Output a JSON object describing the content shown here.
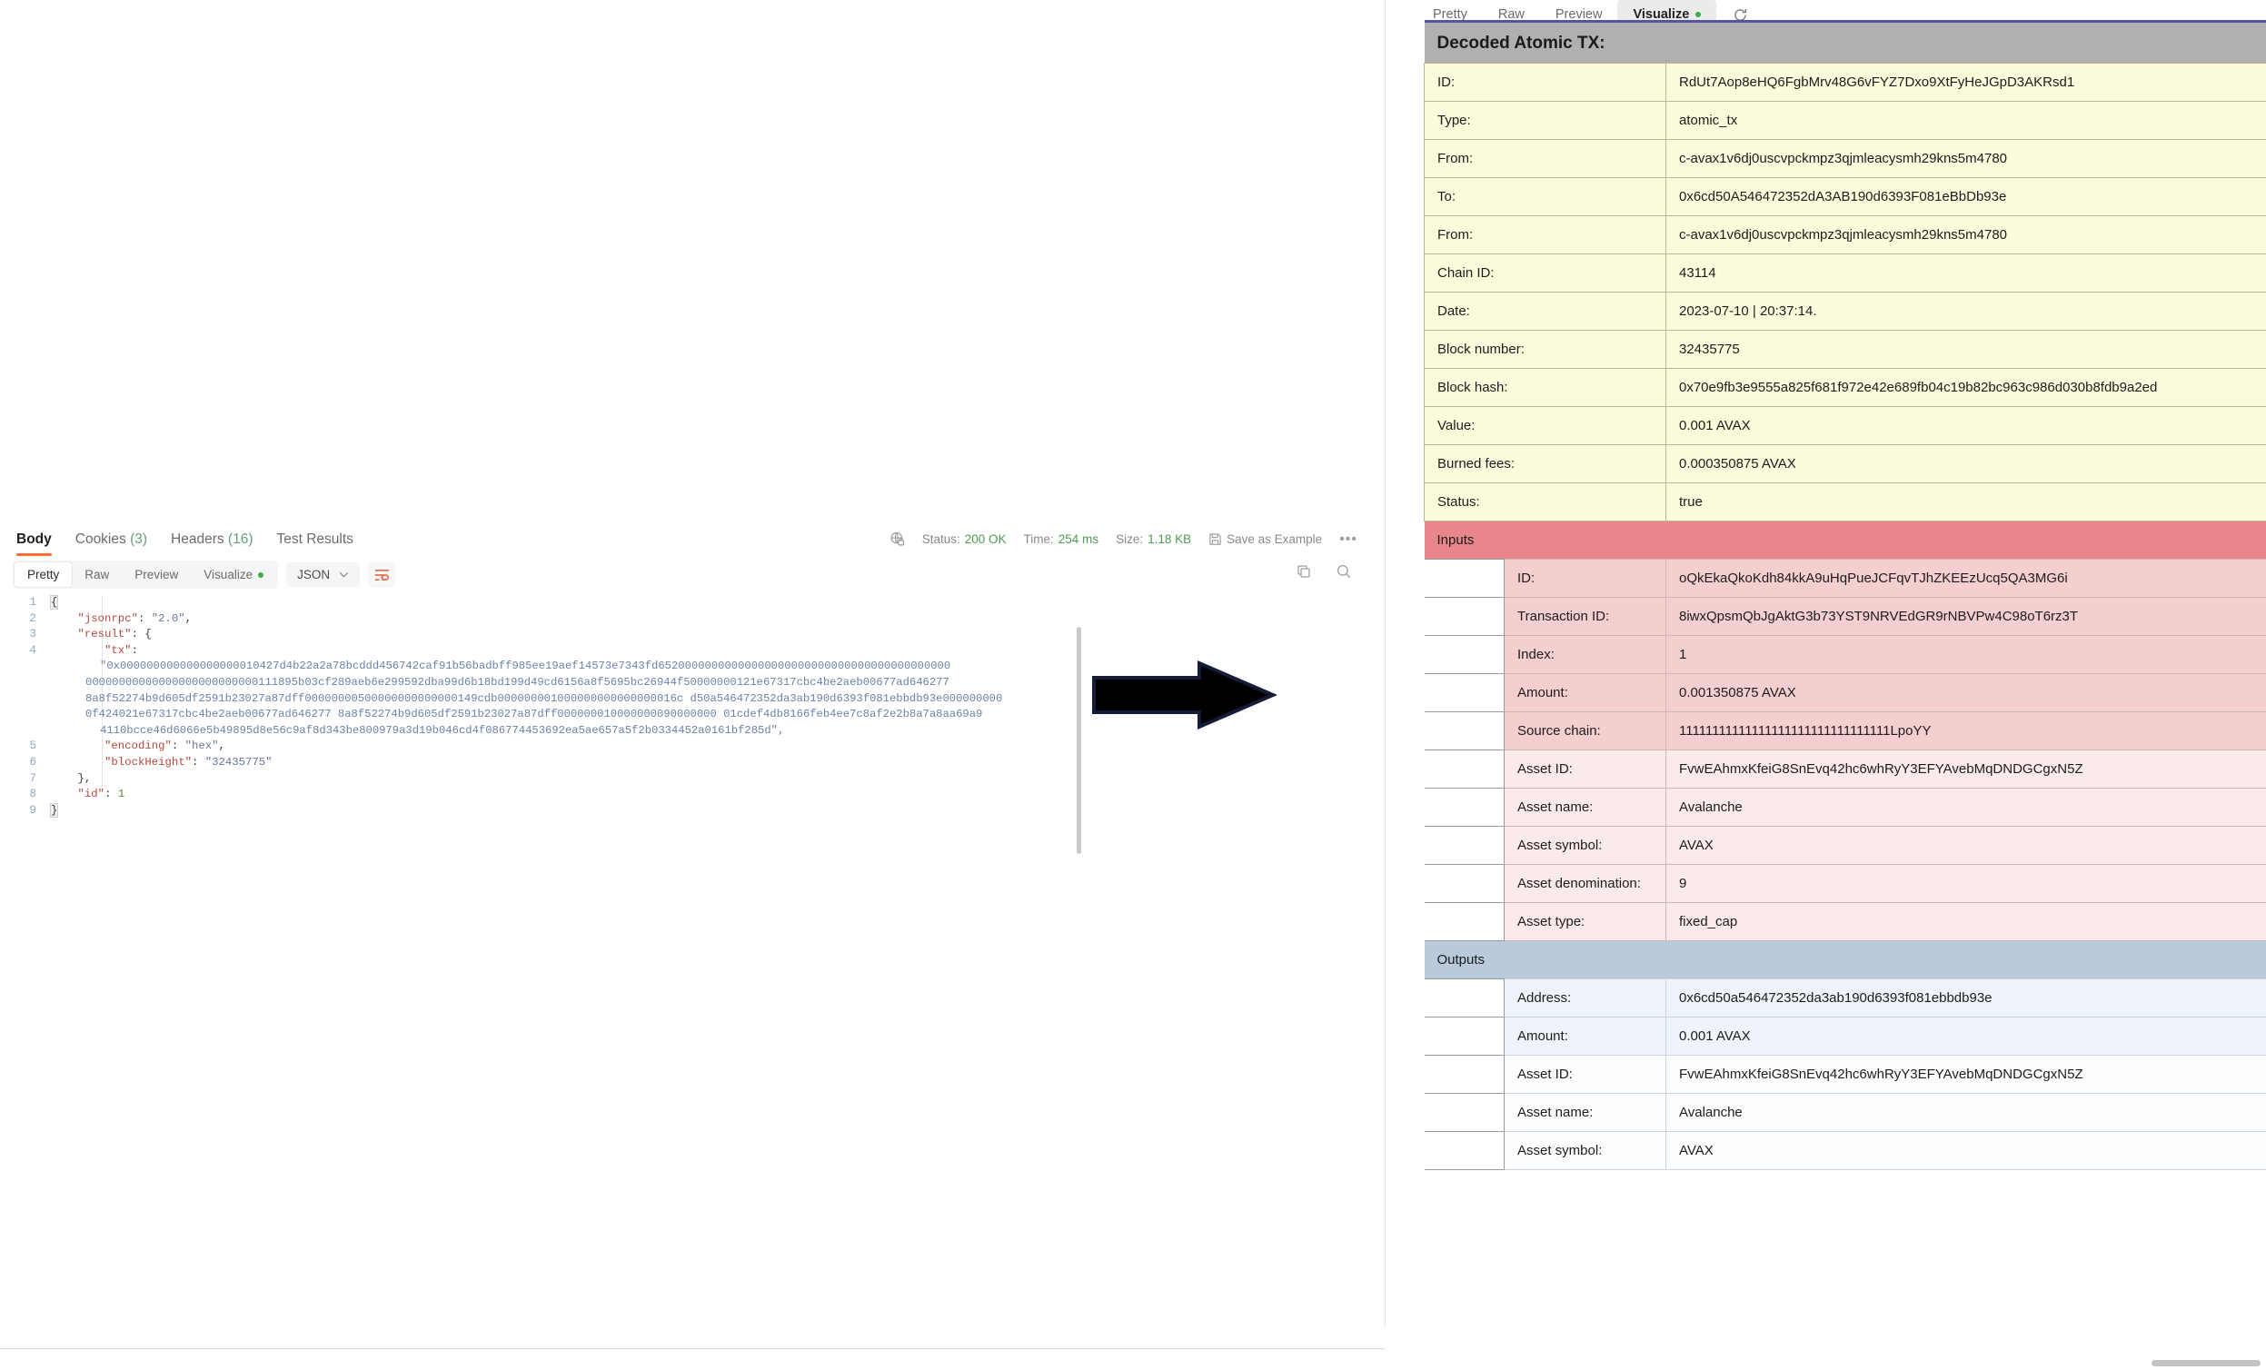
{
  "postman": {
    "response_tabs": [
      {
        "label": "Body",
        "count": "",
        "active": true
      },
      {
        "label": "Cookies",
        "count": "(3)",
        "active": false
      },
      {
        "label": "Headers",
        "count": "(16)",
        "active": false
      },
      {
        "label": "Test Results",
        "count": "",
        "active": false
      }
    ],
    "status": {
      "status_label": "Status:",
      "status_value": "200 OK",
      "time_label": "Time:",
      "time_value": "254 ms",
      "size_label": "Size:",
      "size_value": "1.18 KB",
      "save_as_example": "Save as Example",
      "more": "•••"
    },
    "format_tabs": [
      {
        "label": "Pretty",
        "active": true,
        "dot": false
      },
      {
        "label": "Raw",
        "active": false,
        "dot": false
      },
      {
        "label": "Preview",
        "active": false,
        "dot": false
      },
      {
        "label": "Visualize",
        "active": false,
        "dot": true
      }
    ],
    "language": "JSON",
    "code_lines": [
      {
        "num": "1",
        "type": "plain",
        "text": "{"
      },
      {
        "num": "2",
        "type": "kv",
        "key": "\"jsonrpc\"",
        "val": "\"2.0\"",
        "tail": ","
      },
      {
        "num": "3",
        "type": "open",
        "key": "\"result\"",
        "tail": "{"
      },
      {
        "num": "4",
        "type": "key",
        "key": "\"tx\"",
        "tail": ":"
      },
      {
        "num": "5",
        "type": "kv2",
        "key": "\"encoding\"",
        "val": "\"hex\"",
        "tail": ","
      },
      {
        "num": "6",
        "type": "kv2",
        "key": "\"blockHeight\"",
        "val": "\"32435775\"",
        "tail": ""
      },
      {
        "num": "7",
        "type": "plain2",
        "text": "},"
      },
      {
        "num": "8",
        "type": "kvnum",
        "key": "\"id\"",
        "val": "1",
        "tail": ""
      },
      {
        "num": "9",
        "type": "plain",
        "text": "}"
      }
    ],
    "hex_lines": [
      "\"0x000000000000000000010427d4b22a2a78bcddd456742caf91b56badbff985ee19aef14573e7343fd65200000000000000000000000000000000000000000",
      "00000000000000000000000000111895b03cf289aeb6e299592dba99d6b18bd199d49cd6156a8f5695bc26944f50000000121e67317cbc4be2aeb00677ad646277",
      "8a8f52274b9d605df2591b23027a87dff00000000500000000000000149cdb000000001000000000000000016c d50a546472352da3ab190d6393f081ebbdb93e000000000",
      "0f424021e67317cbc4be2aeb00677ad646277 8a8f52274b9d605df2591b23027a87dff000000010000000090000000 01cdef4db8166feb4ee7c8af2e2b8a7a8aa69a9",
      "4110bcce46d6066e5b49895d8e56c9af8d343be800979a3d19b046cd4f086774453692ea5ae657a5f2b0334452a0161bf285d\","
    ]
  },
  "visualize": {
    "tabs": [
      {
        "label": "Pretty",
        "active": false,
        "dot": false
      },
      {
        "label": "Raw",
        "active": false,
        "dot": false
      },
      {
        "label": "Preview",
        "active": false,
        "dot": false
      },
      {
        "label": "Visualize",
        "active": true,
        "dot": true
      }
    ],
    "title": "Decoded Atomic TX:",
    "main_rows": [
      {
        "label": "ID:",
        "value": "RdUt7Aop8eHQ6FgbMrv48G6vFYZ7Dxo9XtFyHeJGpD3AKRsd1"
      },
      {
        "label": "Type:",
        "value": "atomic_tx"
      },
      {
        "label": "From:",
        "value": "c-avax1v6dj0uscvpckmpz3qjmleacysmh29kns5m4780"
      },
      {
        "label": "To:",
        "value": "0x6cd50A546472352dA3AB190d6393F081eBbDb93e"
      },
      {
        "label": "From:",
        "value": "c-avax1v6dj0uscvpckmpz3qjmleacysmh29kns5m4780"
      },
      {
        "label": "Chain ID:",
        "value": "43114"
      },
      {
        "label": "Date:",
        "value": "2023-07-10 | 20:37:14."
      },
      {
        "label": "Block number:",
        "value": "32435775"
      },
      {
        "label": "Block hash:",
        "value": "0x70e9fb3e9555a825f681f972e42e689fb04c19b82bc963c986d030b8fdb9a2ed"
      },
      {
        "label": "Value:",
        "value": "0.001 AVAX"
      },
      {
        "label": "Burned fees:",
        "value": "0.000350875 AVAX"
      },
      {
        "label": "Status:",
        "value": "true"
      }
    ],
    "inputs_section_label": "Inputs",
    "inputs_rows": [
      {
        "label": "ID:",
        "value": "oQkEkaQkoKdh84kkA9uHqPueJCFqvTJhZKEEzUcq5QA3MG6i"
      },
      {
        "label": "Transaction ID:",
        "value": "8iwxQpsmQbJgAktG3b73YST9NRVEdGR9rNBVPw4C98oT6rz3T"
      },
      {
        "label": "Index:",
        "value": "1"
      },
      {
        "label": "Amount:",
        "value": "0.001350875 AVAX"
      },
      {
        "label": "Source chain:",
        "value": "11111111111111111111111111111111LpoYY"
      },
      {
        "label": "Asset ID:",
        "value": "FvwEAhmxKfeiG8SnEvq42hc6whRyY3EFYAvebMqDNDGCgxN5Z"
      },
      {
        "label": "Asset name:",
        "value": "Avalanche"
      },
      {
        "label": "Asset symbol:",
        "value": "AVAX"
      },
      {
        "label": "Asset denomination:",
        "value": "9"
      },
      {
        "label": "Asset type:",
        "value": "fixed_cap"
      }
    ],
    "outputs_section_label": "Outputs",
    "outputs_rows": [
      {
        "label": "Address:",
        "value": "0x6cd50a546472352da3ab190d6393f081ebbdb93e"
      },
      {
        "label": "Amount:",
        "value": "0.001 AVAX"
      },
      {
        "label": "Asset ID:",
        "value": "FvwEAhmxKfeiG8SnEvq42hc6whRyY3EFYAvebMqDNDGCgxN5Z"
      },
      {
        "label": "Asset name:",
        "value": "Avalanche"
      },
      {
        "label": "Asset symbol:",
        "value": "AVAX"
      }
    ]
  },
  "colors": {
    "accent_orange": "#ff6c37",
    "header_gray": "#b0b0b0",
    "main_yellow": "#fcfcdc",
    "inputs_red": "#e8868c",
    "inputs_row_a": "#f5cfcf",
    "inputs_row_b": "#fbeaea",
    "outputs_blue": "#b8cadc",
    "outputs_row_a": "#eef4fa",
    "status_green": "#4e9a51"
  }
}
